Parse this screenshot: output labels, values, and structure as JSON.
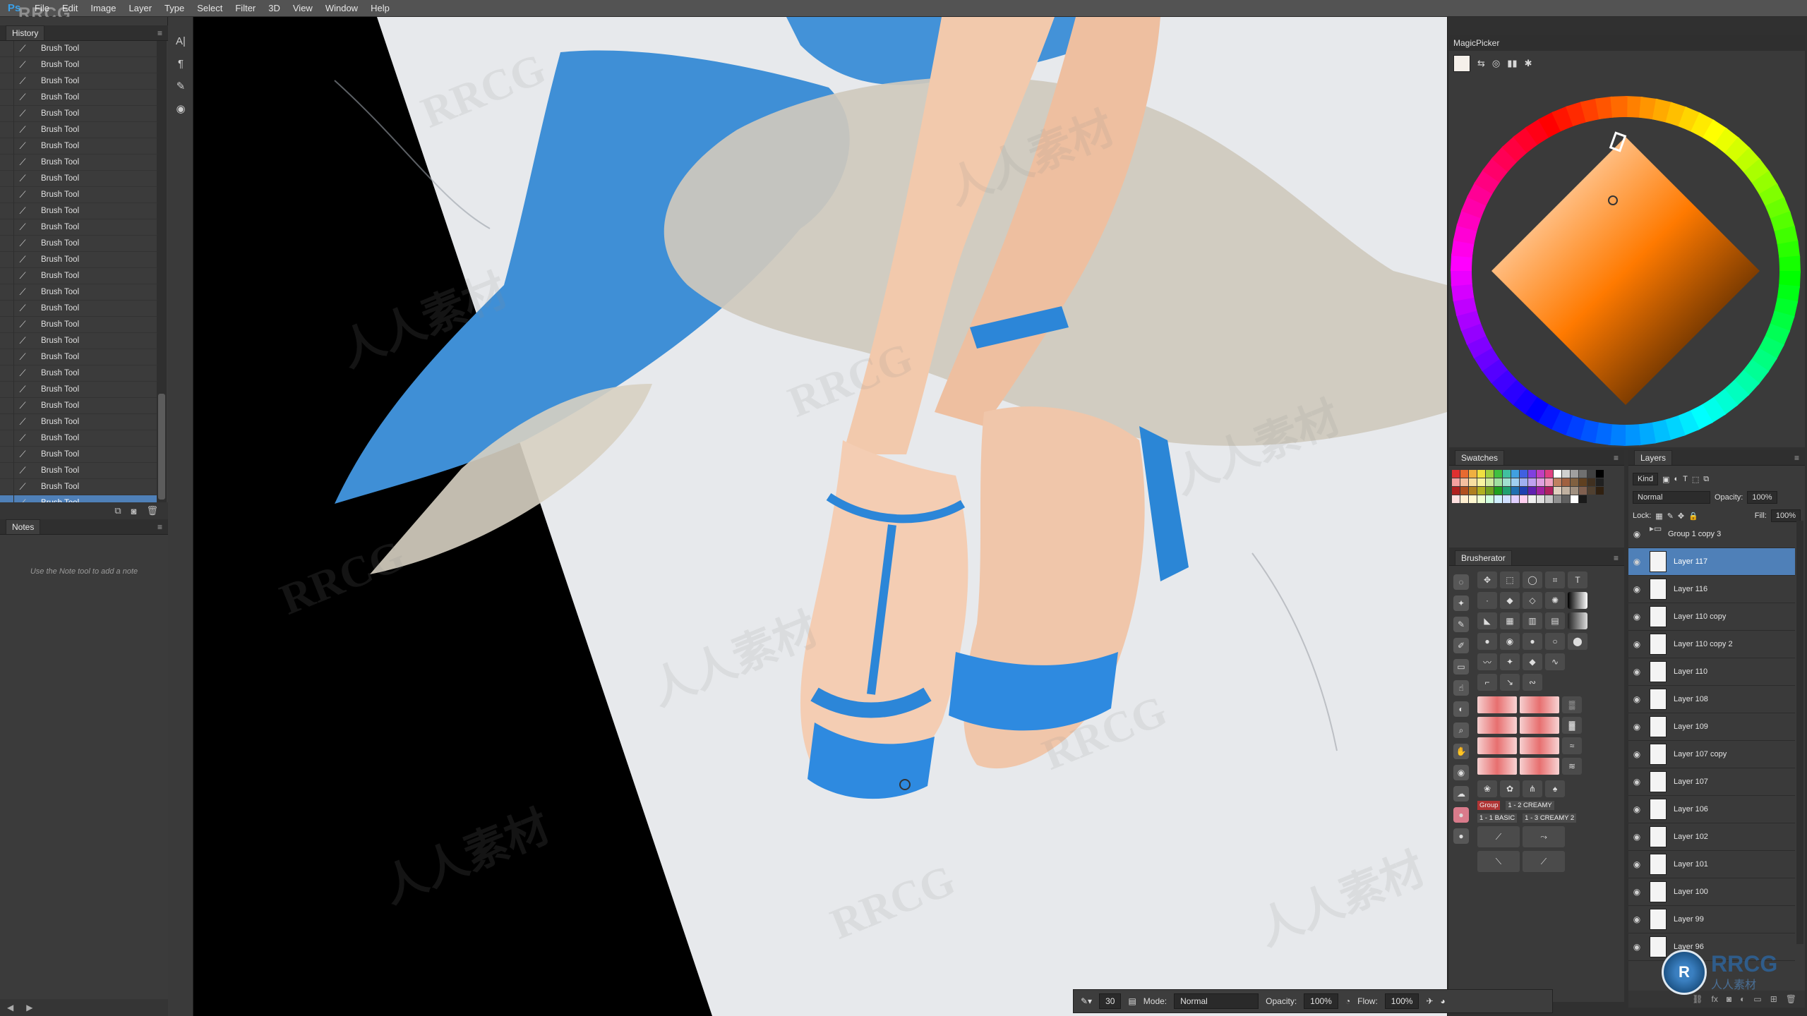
{
  "app": {
    "logo": "Ps",
    "watermark_logo": "RRCG",
    "menu": [
      "File",
      "Edit",
      "Image",
      "Layer",
      "Type",
      "Select",
      "Filter",
      "3D",
      "View",
      "Window",
      "Help"
    ]
  },
  "history": {
    "title": "History",
    "items": [
      "Brush Tool",
      "Brush Tool",
      "Brush Tool",
      "Brush Tool",
      "Brush Tool",
      "Brush Tool",
      "Brush Tool",
      "Brush Tool",
      "Brush Tool",
      "Brush Tool",
      "Brush Tool",
      "Brush Tool",
      "Brush Tool",
      "Brush Tool",
      "Brush Tool",
      "Brush Tool",
      "Brush Tool",
      "Brush Tool",
      "Brush Tool",
      "Brush Tool",
      "Brush Tool",
      "Brush Tool",
      "Brush Tool",
      "Brush Tool",
      "Brush Tool",
      "Brush Tool",
      "Brush Tool",
      "Brush Tool",
      "Brush Tool"
    ],
    "active_index": 28
  },
  "notes": {
    "title": "Notes",
    "hint": "Use the Note tool to add a note"
  },
  "magicpicker": {
    "title": "MagicPicker",
    "selected_hue_color": "#ff7a00",
    "foreground_color": "#f5f0ea"
  },
  "swatches": {
    "title": "Swatches",
    "colors": [
      "#e03030",
      "#e86a30",
      "#f0b040",
      "#f0e040",
      "#a0d040",
      "#40c040",
      "#40c0a0",
      "#40a0e0",
      "#4060e0",
      "#8040e0",
      "#c040c0",
      "#e04080",
      "#ffffff",
      "#d0d0d0",
      "#a0a0a0",
      "#707070",
      "#404040",
      "#000000",
      "#f4a0a0",
      "#f4c0a0",
      "#f8e0a0",
      "#f8f4a0",
      "#d0eaa0",
      "#a0e0a0",
      "#a0e0d0",
      "#a0d0f0",
      "#a0b0f0",
      "#c0a0f0",
      "#e0a0e0",
      "#f0a0c0",
      "#c08060",
      "#a06040",
      "#806040",
      "#604020",
      "#403020",
      "#202020",
      "#b02020",
      "#b05020",
      "#b08020",
      "#b0b020",
      "#70a020",
      "#20a020",
      "#20a070",
      "#2070b0",
      "#2040b0",
      "#6020b0",
      "#a020a0",
      "#b02060",
      "#e0d0c0",
      "#c0b0a0",
      "#a09080",
      "#806050",
      "#504030",
      "#302010",
      "#ffe0e0",
      "#ffeed0",
      "#fff8d0",
      "#f0ffd0",
      "#d0ffe0",
      "#d0f0ff",
      "#d0e0ff",
      "#e0d0ff",
      "#ffd0f0",
      "#f0f0f0",
      "#e0e0e0",
      "#c8c8c8",
      "#909090",
      "#606060",
      "#ffffff",
      "#1a1a1a"
    ]
  },
  "brusherator": {
    "title": "Brusherator",
    "tags": [
      "Group",
      "1 - 2 CREAMY",
      "1 - 1 BASIC",
      "1 - 3 CREAMY 2"
    ]
  },
  "layers": {
    "title": "Layers",
    "filter_kind": "Kind",
    "blend_mode": "Normal",
    "opacity_label": "Opacity:",
    "opacity_value": "100%",
    "lock_label": "Lock:",
    "fill_label": "Fill:",
    "fill_value": "100%",
    "items": [
      {
        "name": "Group 1 copy 3",
        "type": "group",
        "active": false
      },
      {
        "name": "Layer 117",
        "type": "layer",
        "active": true
      },
      {
        "name": "Layer 116",
        "type": "layer",
        "active": false
      },
      {
        "name": "Layer 110 copy",
        "type": "layer",
        "active": false
      },
      {
        "name": "Layer 110 copy 2",
        "type": "layer",
        "active": false
      },
      {
        "name": "Layer 110",
        "type": "layer",
        "active": false
      },
      {
        "name": "Layer 108",
        "type": "layer",
        "active": false
      },
      {
        "name": "Layer 109",
        "type": "layer",
        "active": false
      },
      {
        "name": "Layer 107 copy",
        "type": "layer",
        "active": false
      },
      {
        "name": "Layer 107",
        "type": "layer",
        "active": false
      },
      {
        "name": "Layer 106",
        "type": "layer",
        "active": false
      },
      {
        "name": "Layer 102",
        "type": "layer",
        "active": false
      },
      {
        "name": "Layer 101",
        "type": "layer",
        "active": false
      },
      {
        "name": "Layer 100",
        "type": "layer",
        "active": false
      },
      {
        "name": "Layer 99",
        "type": "layer",
        "active": false
      },
      {
        "name": "Layer 96",
        "type": "layer",
        "active": false
      }
    ]
  },
  "options": {
    "brush_size": "30",
    "mode_label": "Mode:",
    "mode_value": "Normal",
    "opacity_label": "Opacity:",
    "opacity_value": "100%",
    "flow_label": "Flow:",
    "flow_value": "100%"
  },
  "canvas": {
    "watermarks": [
      "RRCG",
      "人人素材"
    ]
  },
  "badge": {
    "name": "RRCG",
    "subtitle": "人人素材"
  }
}
